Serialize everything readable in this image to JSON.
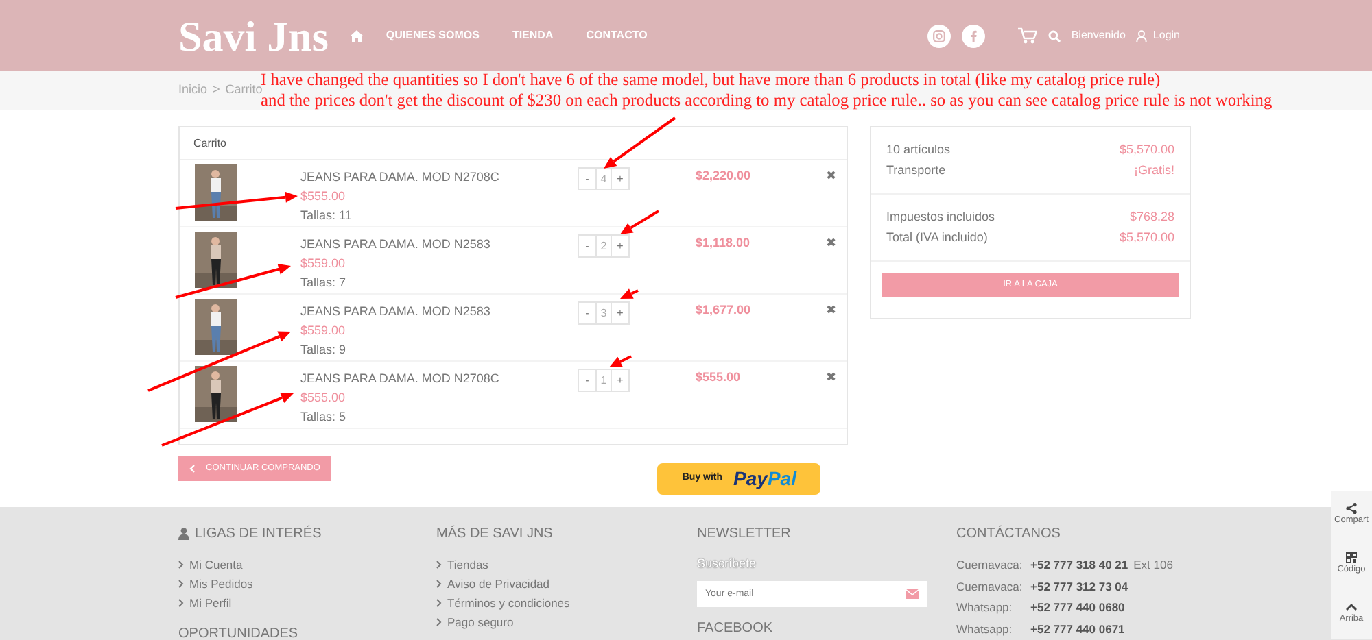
{
  "header": {
    "brand": "Savi Jns",
    "nav": [
      {
        "label": "QUIENES SOMOS"
      },
      {
        "label": "TIENDA"
      },
      {
        "label": "CONTACTO"
      }
    ],
    "welcome": "Bienvenido",
    "login": "Login"
  },
  "breadcrumb": [
    "Inicio",
    ">",
    "Carrito"
  ],
  "annotation": {
    "lines": [
      "I have changed the quantities so I don't have 6 of the same model, but have more than 6 products in total (like my catalog price rule)",
      "and the prices don't get the discount of $230 on each products according to my catalog price rule.. so as you can see catalog price rule is not working"
    ]
  },
  "cart": {
    "title": "Carrito",
    "items": [
      {
        "name": "JEANS PARA DAMA. MOD N2708C",
        "price": "$555.00",
        "size": "Tallas: 11",
        "minus": "-",
        "qty": "4",
        "plus": "+",
        "total": "$2,220.00",
        "remove": "✖"
      },
      {
        "name": "JEANS PARA DAMA. MOD N2583",
        "price": "$559.00",
        "size": "Tallas: 7",
        "minus": "-",
        "qty": "2",
        "plus": "+",
        "total": "$1,118.00",
        "remove": "✖"
      },
      {
        "name": "JEANS PARA DAMA. MOD N2583",
        "price": "$559.00",
        "size": "Tallas: 9",
        "minus": "-",
        "qty": "3",
        "plus": "+",
        "total": "$1,677.00",
        "remove": "✖"
      },
      {
        "name": "JEANS PARA DAMA. MOD N2708C",
        "price": "$555.00",
        "size": "Tallas: 5",
        "minus": "-",
        "qty": "1",
        "plus": "+",
        "total": "$555.00",
        "remove": "✖"
      }
    ],
    "continue": "CONTINUAR COMPRANDO"
  },
  "summary": {
    "groups": [
      [
        {
          "label": "10 artículos",
          "value": "$5,570.00"
        },
        {
          "label": "Transporte",
          "value": "¡Gratis!"
        }
      ],
      [
        {
          "label": "Impuestos incluidos",
          "value": "$768.28"
        },
        {
          "label": "Total (IVA incluido)",
          "value": "$5,570.00"
        }
      ]
    ],
    "checkout": "IR A LA CAJA"
  },
  "paypal": {
    "prefix": "Buy with",
    "logo": [
      "Pay",
      "Pal"
    ]
  },
  "footer": {
    "columns": [
      {
        "heading": "LIGAS DE INTERÉS",
        "links": [
          "Mi Cuenta",
          "Mis Pedidos",
          "Mi Perfil"
        ],
        "next_heading": "OPORTUNIDADES"
      },
      {
        "heading": "MÁS DE SAVI JNS",
        "links": [
          "Tiendas",
          "Aviso de Privacidad",
          "Términos y condiciones",
          "Pago seguro"
        ]
      }
    ],
    "newsletter": {
      "heading": "NEWSLETTER",
      "subtitle": "Suscríbete",
      "placeholder": "Your e-mail",
      "next_heading": "FACEBOOK"
    },
    "contact": {
      "heading": "CONTÁCTANOS",
      "rows": [
        {
          "label": "Cuernavaca:",
          "phone": "+52 777 318 40 21",
          "extra": "Ext 106"
        },
        {
          "label": "Cuernavaca:",
          "phone": "+52 777 312 73 04"
        },
        {
          "label": "Whatsapp:",
          "phone": "+52 777 440 0680"
        },
        {
          "label": "Whatsapp:",
          "phone": "+52 777 440 0671"
        }
      ]
    }
  },
  "side_tools": [
    {
      "kind": "share",
      "label": "Compart"
    },
    {
      "kind": "qr",
      "label": "Código"
    },
    {
      "kind": "up",
      "label": "Arriba"
    }
  ]
}
